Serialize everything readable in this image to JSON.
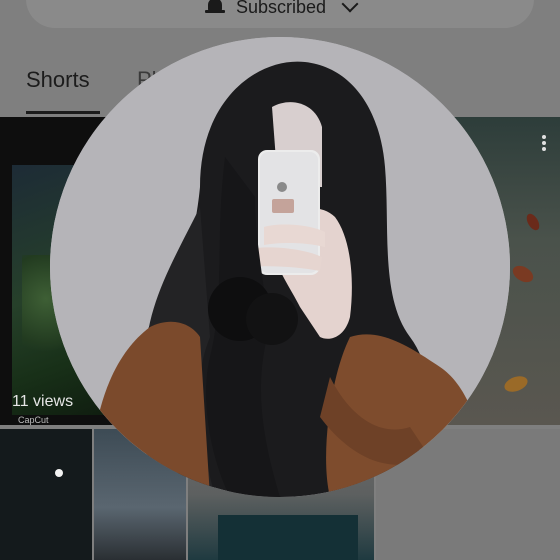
{
  "header": {
    "subscribe_label": "Subscribed",
    "bell_icon": "bell-icon",
    "chevron_icon": "chevron-down-icon"
  },
  "tabs": [
    {
      "label": "Shorts",
      "selected": true
    },
    {
      "label": "Pl",
      "selected": false
    }
  ],
  "shorts": [
    {
      "views": "11 views",
      "watermark": "CapCut"
    }
  ],
  "avatar": {
    "icon": "profile-picture",
    "background_color": "#b5b4b8"
  },
  "colors": {
    "overlay": "#7f7f7f",
    "text": "#1c1c1c"
  }
}
